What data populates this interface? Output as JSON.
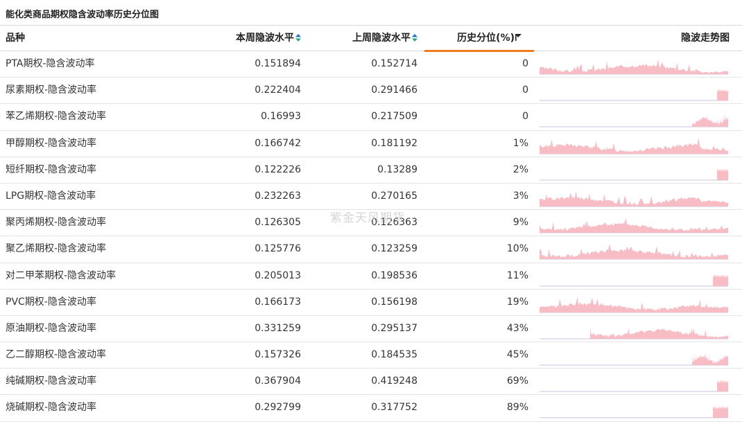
{
  "title": "能化类商品期权隐含波动率历史分位图",
  "headers": {
    "name": "品种",
    "current": "本周隐波水平",
    "previous": "上周隐波水平",
    "percentile": "历史分位(%)",
    "trend": "隐波走势图"
  },
  "watermark": "紫金天风期货",
  "colors": {
    "accent_sort_up": "#1a73c8",
    "accent_sort_down": "#2aa58a",
    "active_underline": "#f07c1e",
    "sparkline_fill": "#f8bcc4",
    "sparkline_base": "#c9c2de"
  },
  "rows": [
    {
      "name": "PTA期权-隐含波动率",
      "current": "0.151894",
      "previous": "0.152714",
      "percentile": "0",
      "spark_start": 0.0,
      "spark_seed": 3
    },
    {
      "name": "尿素期权-隐含波动率",
      "current": "0.222404",
      "previous": "0.291466",
      "percentile": "0",
      "spark_start": 0.94,
      "spark_seed": 7
    },
    {
      "name": "苯乙烯期权-隐含波动率",
      "current": "0.16993",
      "previous": "0.217509",
      "percentile": "0",
      "spark_start": 0.81,
      "spark_seed": 11
    },
    {
      "name": "甲醇期权-隐含波动率",
      "current": "0.166742",
      "previous": "0.181192",
      "percentile": "1%",
      "spark_start": 0.0,
      "spark_seed": 13
    },
    {
      "name": "短纤期权-隐含波动率",
      "current": "0.122226",
      "previous": "0.13289",
      "percentile": "2%",
      "spark_start": 0.94,
      "spark_seed": 17
    },
    {
      "name": "LPG期权-隐含波动率",
      "current": "0.232263",
      "previous": "0.270165",
      "percentile": "3%",
      "spark_start": 0.0,
      "spark_seed": 19
    },
    {
      "name": "聚丙烯期权-隐含波动率",
      "current": "0.126305",
      "previous": "0.126363",
      "percentile": "9%",
      "spark_start": 0.0,
      "spark_seed": 23
    },
    {
      "name": "聚乙烯期权-隐含波动率",
      "current": "0.125776",
      "previous": "0.123259",
      "percentile": "10%",
      "spark_start": 0.0,
      "spark_seed": 29
    },
    {
      "name": "对二甲苯期权-隐含波动率",
      "current": "0.205013",
      "previous": "0.198536",
      "percentile": "11%",
      "spark_start": 0.92,
      "spark_seed": 31
    },
    {
      "name": "PVC期权-隐含波动率",
      "current": "0.166173",
      "previous": "0.156198",
      "percentile": "19%",
      "spark_start": 0.0,
      "spark_seed": 37
    },
    {
      "name": "原油期权-隐含波动率",
      "current": "0.331259",
      "previous": "0.295137",
      "percentile": "43%",
      "spark_start": 0.27,
      "spark_seed": 41
    },
    {
      "name": "乙二醇期权-隐含波动率",
      "current": "0.157326",
      "previous": "0.184535",
      "percentile": "45%",
      "spark_start": 0.81,
      "spark_seed": 43
    },
    {
      "name": "纯碱期权-隐含波动率",
      "current": "0.367904",
      "previous": "0.419248",
      "percentile": "69%",
      "spark_start": 0.94,
      "spark_seed": 47
    },
    {
      "name": "烧碱期权-隐含波动率",
      "current": "0.292799",
      "previous": "0.317752",
      "percentile": "89%",
      "spark_start": 0.92,
      "spark_seed": 53
    }
  ]
}
